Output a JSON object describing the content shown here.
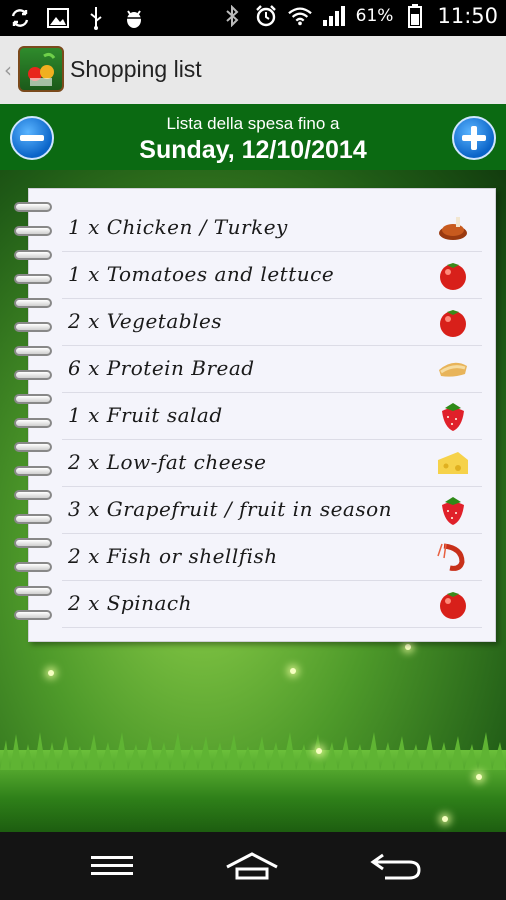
{
  "status_bar": {
    "battery": "61%",
    "time": "11:50",
    "left_icons": [
      "sync-icon",
      "image-icon",
      "usb-icon",
      "android-debug-icon"
    ],
    "right_icons": [
      "bluetooth-icon",
      "alarm-icon",
      "wifi-icon",
      "signal-icon",
      "battery-icon"
    ]
  },
  "action_bar": {
    "title": "Shopping list"
  },
  "header": {
    "subtitle": "Lista della spesa fino a",
    "date": "Sunday, 12/10/2014",
    "minus_icon": "minus-icon",
    "plus_icon": "plus-icon"
  },
  "list": {
    "items": [
      {
        "text": "1 x Chicken / Turkey",
        "icon": "chicken-icon"
      },
      {
        "text": "1 x Tomatoes and lettuce",
        "icon": "tomato-icon"
      },
      {
        "text": "2 x Vegetables",
        "icon": "tomato-icon"
      },
      {
        "text": "6 x Protein Bread",
        "icon": "bread-icon"
      },
      {
        "text": "1 x Fruit salad",
        "icon": "strawberry-icon"
      },
      {
        "text": "2 x Low-fat cheese",
        "icon": "cheese-icon"
      },
      {
        "text": "3 x Grapefruit / fruit in season",
        "icon": "strawberry-icon"
      },
      {
        "text": "2 x Fish or shellfish",
        "icon": "shrimp-icon"
      },
      {
        "text": "2 x Spinach",
        "icon": "tomato-icon"
      }
    ]
  },
  "nav_bar": {
    "icons": [
      "menu-icon",
      "home-icon",
      "back-icon"
    ]
  },
  "colors": {
    "header_green": "#0b6a12",
    "button_blue": "#0a64c8",
    "paper": "#f4f4fb"
  }
}
